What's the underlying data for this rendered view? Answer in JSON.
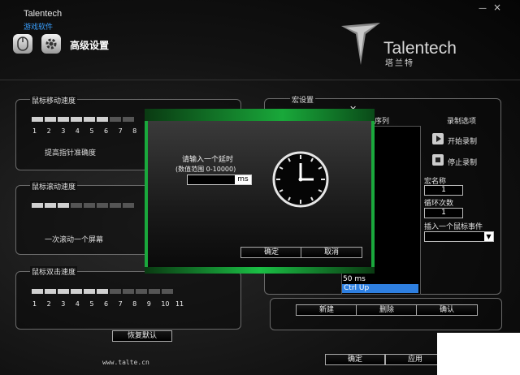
{
  "app": {
    "brand": "Talentech",
    "subtitle": "游戏软件",
    "page_title": "高级设置",
    "minimize_glyph": "—",
    "close_glyph": "×"
  },
  "logo": {
    "text": "Talentech",
    "cn": "塔兰特"
  },
  "mouse_speed": {
    "title": "鼠标移动速度",
    "ticks": [
      "1",
      "2",
      "3",
      "4",
      "5",
      "6",
      "7",
      "8"
    ],
    "level": 6,
    "checkbox_label": "提高指针准确度"
  },
  "scroll_speed": {
    "title": "鼠标滚动速度",
    "level": 3,
    "option_label": "一次滚动一个屏幕"
  },
  "dblclick_speed": {
    "title": "鼠标双击速度",
    "ticks": [
      "1",
      "2",
      "3",
      "4",
      "5",
      "6",
      "7",
      "8",
      "9",
      "10",
      "11"
    ],
    "level": 6
  },
  "restore_button": "恢复默认",
  "website": "www.talte.cn",
  "macro": {
    "title": "宏设置",
    "close_glyph": "✕",
    "sequence_header": "键序列",
    "record_header": "录制选项",
    "start_record": "开始录制",
    "stop_record": "停止录制",
    "macro_name_label": "宏名称",
    "macro_name_value": "1",
    "loop_count_label": "循环次数",
    "loop_count_value": "1",
    "insert_event_label": "插入一个鼠标事件",
    "insert_event_value": "",
    "list_items": [
      "50 ms",
      "Ctrl   Up"
    ],
    "new_button": "新建",
    "delete_button": "删除",
    "confirm_button": "确认"
  },
  "dialog": {
    "prompt": "请输入一个延时",
    "range": "(数值范围 0-10000)",
    "input_value": "",
    "unit": "ms",
    "ok_button": "确定",
    "cancel_button": "取消"
  },
  "footer": {
    "ok_button": "确定",
    "apply_button": "应用"
  }
}
